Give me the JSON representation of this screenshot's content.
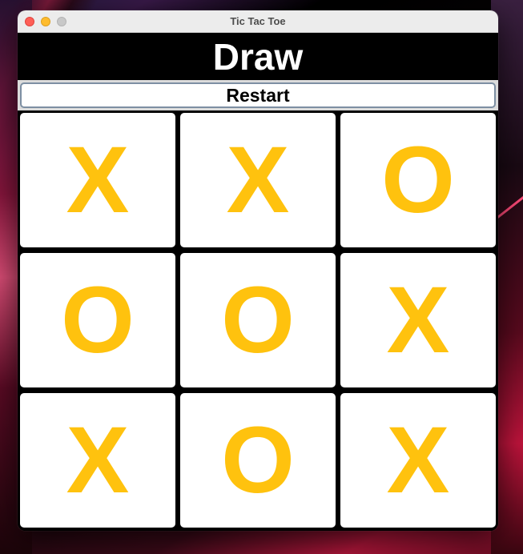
{
  "window": {
    "title": "Tic Tac Toe"
  },
  "status": {
    "text": "Draw"
  },
  "controls": {
    "restart_label": "Restart"
  },
  "colors": {
    "mark": "#ffc20e",
    "cell": "#ffffff",
    "board_background": "#000000"
  },
  "board": {
    "cells": [
      "X",
      "X",
      "O",
      "O",
      "O",
      "X",
      "X",
      "O",
      "X"
    ]
  }
}
